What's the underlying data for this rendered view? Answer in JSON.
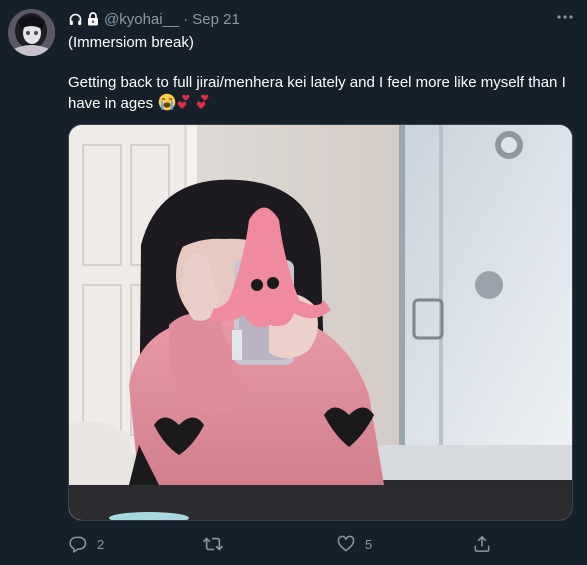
{
  "tweet": {
    "handle": "@kyohai__",
    "separator": "·",
    "date": "Sep 21",
    "line1": "(Immersiom break)",
    "line2": "Getting back to full jirai/menhera kei lately and I feel more like myself than I have in ages",
    "emojis": [
      "loudly-crying-face",
      "two-hearts",
      "two-hearts"
    ]
  },
  "header_icons": [
    "headphones-icon",
    "lock-icon"
  ],
  "actions": {
    "reply_count": "2",
    "retweet_count": "",
    "like_count": "5"
  },
  "media": {
    "description_icons": [
      "squid-sticker-icon"
    ]
  },
  "colors": {
    "background": "#15202b",
    "secondary_text": "#8899a6",
    "primary_text": "#ffffff",
    "border": "#38444d",
    "heart": "#e0245e",
    "squid": "#f08a9e"
  }
}
